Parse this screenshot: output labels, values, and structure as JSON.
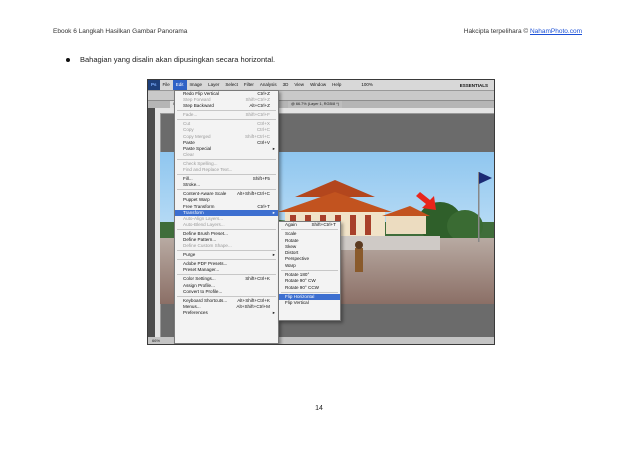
{
  "header": {
    "left": "Ebook 6 Langkah Hasilkan Gambar Panorama",
    "right_prefix": "Hakcipta terpelihara © ",
    "right_link": "NahamPhoto.com"
  },
  "bullet_text": "Bahagian yang disalin akan dipusingkan secara horizontal.",
  "page_number": "14",
  "screenshot": {
    "menubar": [
      "Ps",
      "File",
      "Edit",
      "Image",
      "Layer",
      "Select",
      "Filter",
      "Analysis",
      "3D",
      "View",
      "Window",
      "Help"
    ],
    "zoom": "100%",
    "workspace": "ESSENTIALS",
    "tab1": "Untitled_Pan",
    "tab2": "@ 66.7% (Layer 1, RGB/8 *)",
    "status": "66%",
    "edit_menu": [
      {
        "label": "Redo Flip Vertical",
        "shortcut": "Ctrl+Z",
        "state": "normal"
      },
      {
        "label": "Step Forward",
        "shortcut": "Shift+Ctrl+Z",
        "state": "disabled"
      },
      {
        "label": "Step Backward",
        "shortcut": "Alt+Ctrl+Z",
        "state": "normal"
      },
      {
        "sep": true
      },
      {
        "label": "Fade...",
        "shortcut": "Shift+Ctrl+F",
        "state": "disabled"
      },
      {
        "sep": true
      },
      {
        "label": "Cut",
        "shortcut": "Ctrl+X",
        "state": "disabled"
      },
      {
        "label": "Copy",
        "shortcut": "Ctrl+C",
        "state": "disabled"
      },
      {
        "label": "Copy Merged",
        "shortcut": "Shift+Ctrl+C",
        "state": "disabled"
      },
      {
        "label": "Paste",
        "shortcut": "Ctrl+V",
        "state": "normal"
      },
      {
        "label": "Paste Special",
        "shortcut": "",
        "state": "normal",
        "sub": true
      },
      {
        "label": "Clear",
        "shortcut": "",
        "state": "disabled"
      },
      {
        "sep": true
      },
      {
        "label": "Check Spelling...",
        "shortcut": "",
        "state": "disabled"
      },
      {
        "label": "Find and Replace Text...",
        "shortcut": "",
        "state": "disabled"
      },
      {
        "sep": true
      },
      {
        "label": "Fill...",
        "shortcut": "Shift+F5",
        "state": "normal"
      },
      {
        "label": "Stroke...",
        "shortcut": "",
        "state": "normal"
      },
      {
        "sep": true
      },
      {
        "label": "Content-Aware Scale",
        "shortcut": "Alt+Shift+Ctrl+C",
        "state": "normal"
      },
      {
        "label": "Puppet Warp",
        "shortcut": "",
        "state": "normal"
      },
      {
        "label": "Free Transform",
        "shortcut": "Ctrl+T",
        "state": "normal"
      },
      {
        "label": "Transform",
        "shortcut": "",
        "state": "highlight",
        "sub": true
      },
      {
        "label": "Auto-Align Layers...",
        "shortcut": "",
        "state": "disabled"
      },
      {
        "label": "Auto-Blend Layers...",
        "shortcut": "",
        "state": "disabled"
      },
      {
        "sep": true
      },
      {
        "label": "Define Brush Preset...",
        "shortcut": "",
        "state": "normal"
      },
      {
        "label": "Define Pattern...",
        "shortcut": "",
        "state": "normal"
      },
      {
        "label": "Define Custom Shape...",
        "shortcut": "",
        "state": "disabled"
      },
      {
        "sep": true
      },
      {
        "label": "Purge",
        "shortcut": "",
        "state": "normal",
        "sub": true
      },
      {
        "sep": true
      },
      {
        "label": "Adobe PDF Presets...",
        "shortcut": "",
        "state": "normal"
      },
      {
        "label": "Preset Manager...",
        "shortcut": "",
        "state": "normal"
      },
      {
        "sep": true
      },
      {
        "label": "Color Settings...",
        "shortcut": "Shift+Ctrl+K",
        "state": "normal"
      },
      {
        "label": "Assign Profile...",
        "shortcut": "",
        "state": "normal"
      },
      {
        "label": "Convert to Profile...",
        "shortcut": "",
        "state": "normal"
      },
      {
        "sep": true
      },
      {
        "label": "Keyboard Shortcuts...",
        "shortcut": "Alt+Shift+Ctrl+K",
        "state": "normal"
      },
      {
        "label": "Menus...",
        "shortcut": "Alt+Shift+Ctrl+M",
        "state": "normal"
      },
      {
        "label": "Preferences",
        "shortcut": "",
        "state": "normal",
        "sub": true
      }
    ],
    "transform_menu": [
      {
        "label": "Again",
        "shortcut": "Shift+Ctrl+T",
        "state": "normal"
      },
      {
        "sep": true
      },
      {
        "label": "Scale",
        "shortcut": "",
        "state": "normal"
      },
      {
        "label": "Rotate",
        "shortcut": "",
        "state": "normal"
      },
      {
        "label": "Skew",
        "shortcut": "",
        "state": "normal"
      },
      {
        "label": "Distort",
        "shortcut": "",
        "state": "normal"
      },
      {
        "label": "Perspective",
        "shortcut": "",
        "state": "normal"
      },
      {
        "label": "Warp",
        "shortcut": "",
        "state": "normal"
      },
      {
        "sep": true
      },
      {
        "label": "Rotate 180°",
        "shortcut": "",
        "state": "normal"
      },
      {
        "label": "Rotate 90° CW",
        "shortcut": "",
        "state": "normal"
      },
      {
        "label": "Rotate 90° CCW",
        "shortcut": "",
        "state": "normal"
      },
      {
        "sep": true
      },
      {
        "label": "Flip Horizontal",
        "shortcut": "",
        "state": "highlight"
      },
      {
        "label": "Flip Vertical",
        "shortcut": "",
        "state": "normal"
      }
    ]
  },
  "colors": {
    "link": "#1a4fd6",
    "menu_highlight": "#3d6fd0",
    "arrow_red": "#e8251c"
  }
}
